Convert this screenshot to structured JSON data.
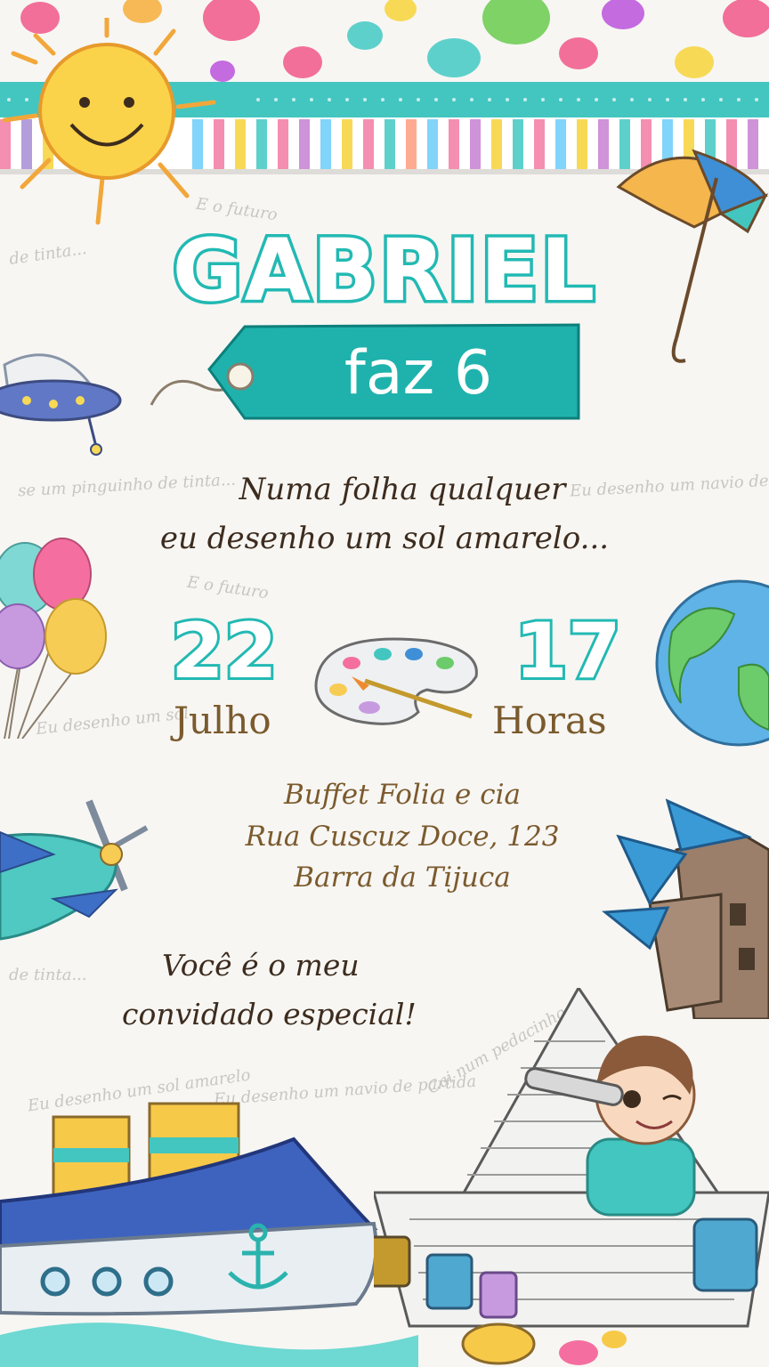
{
  "title": {
    "name": "GABRIEL",
    "tag": "faz 6"
  },
  "poem": {
    "line1": "Numa folha qualquer",
    "line2": "eu desenho um sol amarelo..."
  },
  "event": {
    "day": "22",
    "month": "Julho",
    "hour": "17",
    "hour_label": "Horas"
  },
  "address": {
    "line1": "Buffet Folia e cia",
    "line2": "Rua Cuscuz Doce, 123",
    "line3": "Barra da Tijuca"
  },
  "invite": {
    "line1": "Você é o meu",
    "line2": "convidado especial!"
  },
  "colors": {
    "teal": "#22b9b3",
    "brown": "#7b5a2d",
    "dark_text": "#3d2c1e"
  }
}
